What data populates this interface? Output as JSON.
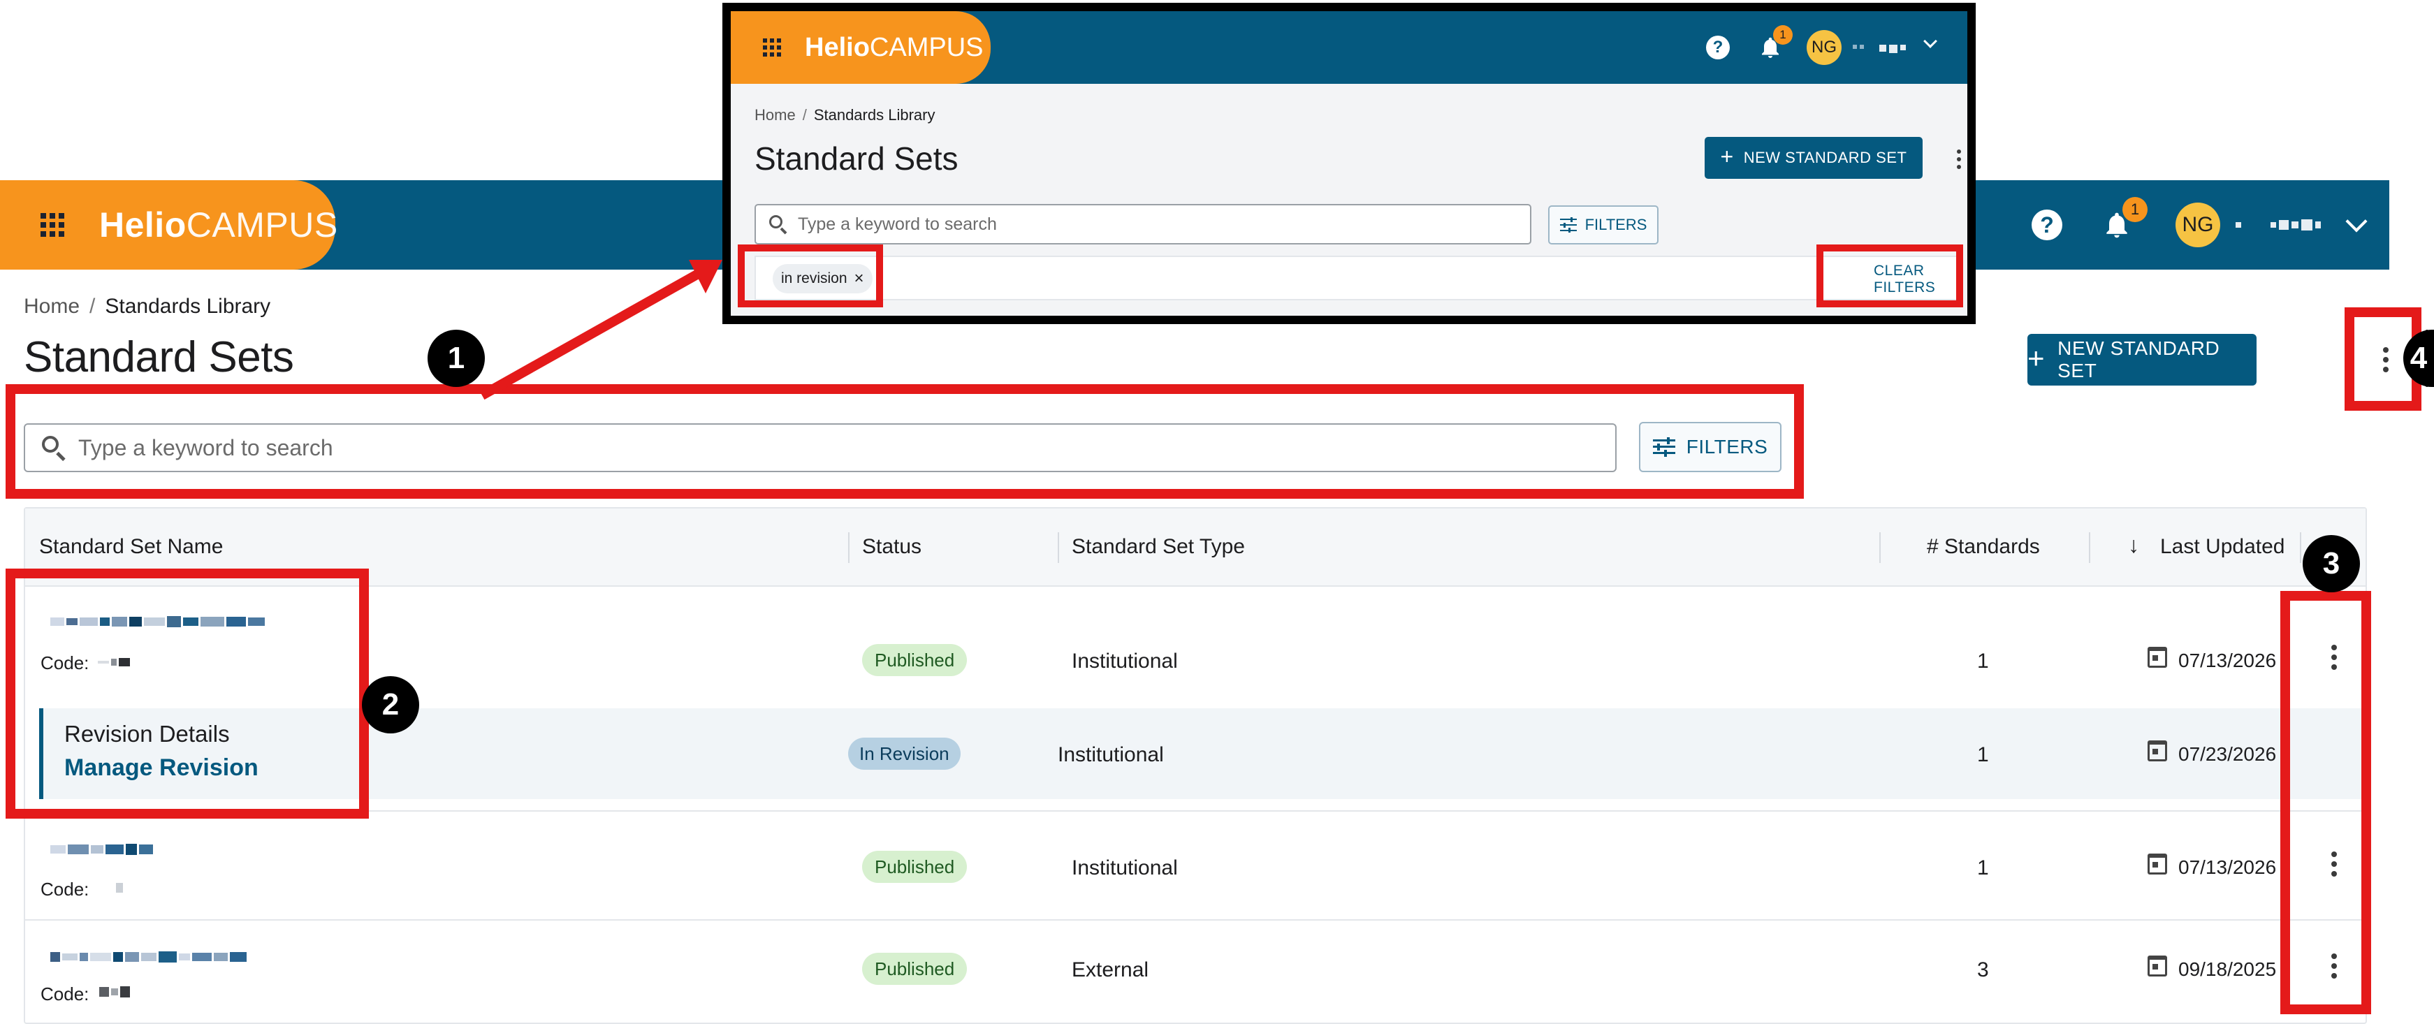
{
  "app": {
    "brand_bold": "Helio",
    "brand_light": "CAMPUS",
    "help_label": "?",
    "notifications_count": "1",
    "user_initials": "NG"
  },
  "breadcrumb": {
    "home": "Home",
    "separator": "/",
    "current": "Standards Library"
  },
  "page_title": "Standard Sets",
  "new_button_label": "NEW STANDARD SET",
  "search": {
    "placeholder": "Type a keyword to search"
  },
  "filters_label": "FILTERS",
  "table": {
    "columns": [
      "Standard Set Name",
      "Status",
      "Standard Set Type",
      "# Standards",
      "Last Updated"
    ],
    "code_label": "Code:",
    "rows": [
      {
        "status": "Published",
        "type": "Institutional",
        "standards": "1",
        "updated": "07/13/2026"
      },
      {
        "status": "In Revision",
        "type": "Institutional",
        "standards": "1",
        "updated": "07/23/2026",
        "revision_title": "Revision Details",
        "revision_link": "Manage Revision"
      },
      {
        "status": "Published",
        "type": "Institutional",
        "standards": "1",
        "updated": "07/13/2026"
      },
      {
        "status": "Published",
        "type": "External",
        "standards": "3",
        "updated": "09/18/2025"
      }
    ]
  },
  "inset": {
    "chip_label": "in revision",
    "chip_close": "×",
    "clear_filters": "CLEAR FILTERS"
  },
  "annotations": [
    "1",
    "2",
    "3",
    "4"
  ],
  "colors": {
    "brand_orange": "#f7941d",
    "brand_blue": "#05597f",
    "annotation_red": "#e41a1a"
  }
}
